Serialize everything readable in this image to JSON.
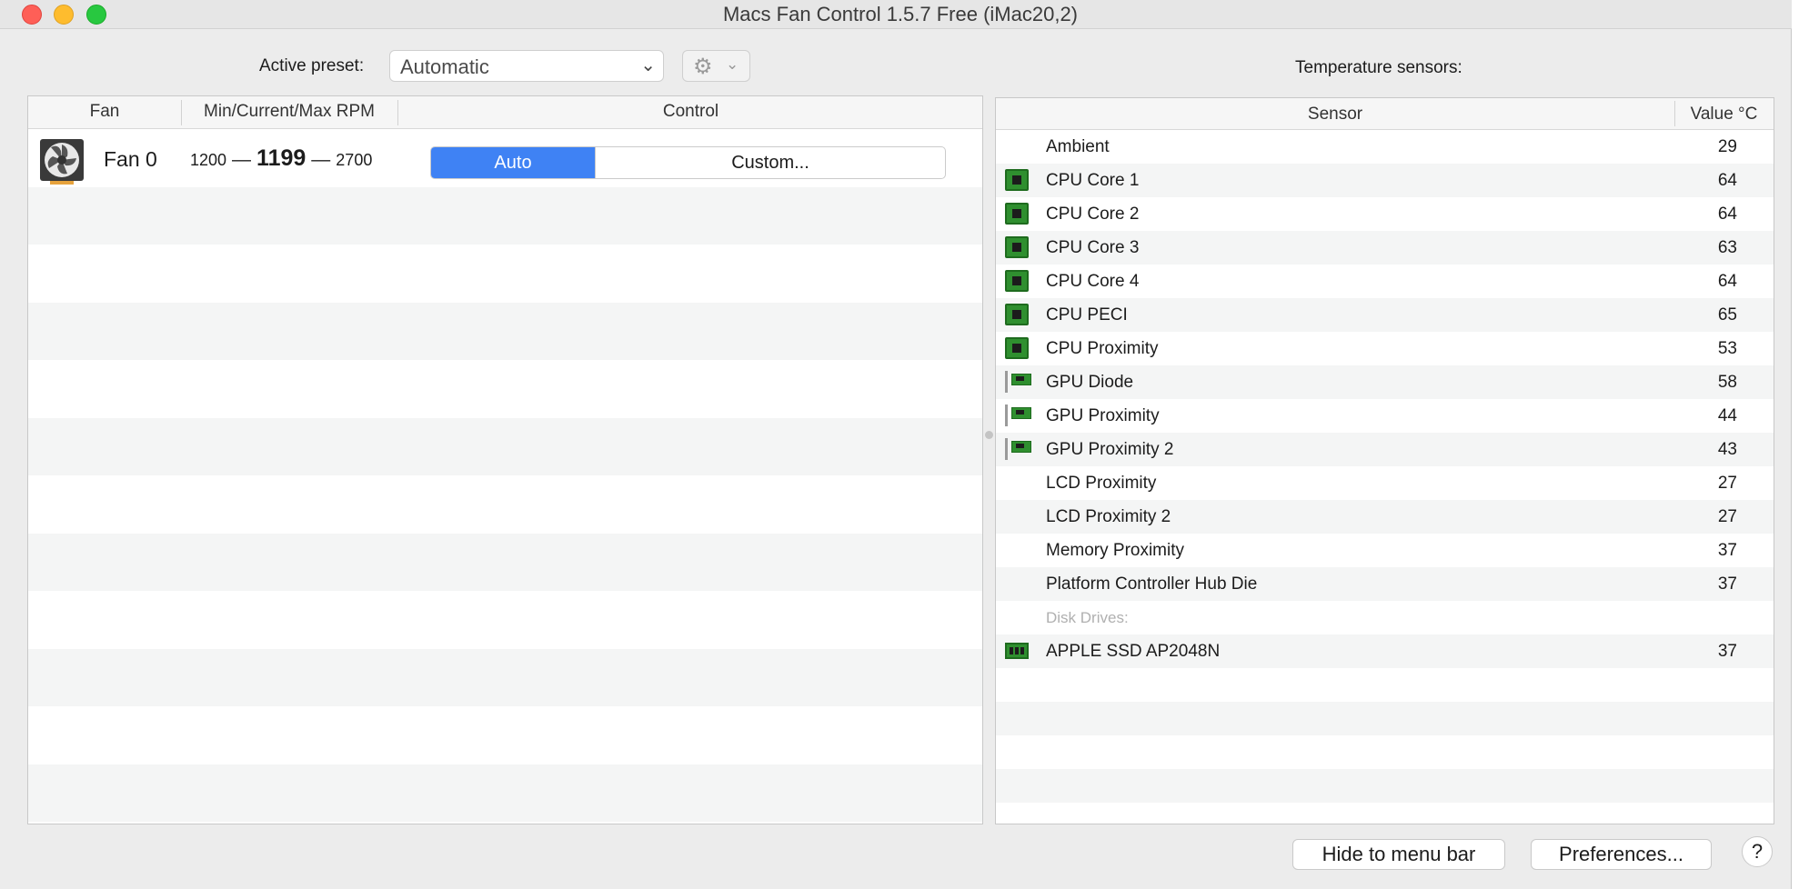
{
  "window": {
    "title": "Macs Fan Control 1.5.7 Free (iMac20,2)"
  },
  "toolbar": {
    "preset_label": "Active preset:",
    "preset_value": "Automatic"
  },
  "fans": {
    "headers": {
      "fan": "Fan",
      "rpm": "Min/Current/Max RPM",
      "control": "Control"
    },
    "rows": [
      {
        "name": "Fan 0",
        "min": "1200",
        "current": "1199",
        "max": "2700",
        "dash": "—",
        "control_auto": "Auto",
        "control_custom": "Custom...",
        "selected": "Auto"
      }
    ]
  },
  "sensors": {
    "caption": "Temperature sensors:",
    "headers": {
      "sensor": "Sensor",
      "value": "Value °C"
    },
    "rows": [
      {
        "icon": "none",
        "name": "Ambient",
        "value": "29"
      },
      {
        "icon": "cpu-chip-icon",
        "name": "CPU Core 1",
        "value": "64"
      },
      {
        "icon": "cpu-chip-icon",
        "name": "CPU Core 2",
        "value": "64"
      },
      {
        "icon": "cpu-chip-icon",
        "name": "CPU Core 3",
        "value": "63"
      },
      {
        "icon": "cpu-chip-icon",
        "name": "CPU Core 4",
        "value": "64"
      },
      {
        "icon": "cpu-chip-icon",
        "name": "CPU PECI",
        "value": "65"
      },
      {
        "icon": "cpu-chip-icon",
        "name": "CPU Proximity",
        "value": "53"
      },
      {
        "icon": "gpu-card-icon",
        "name": "GPU Diode",
        "value": "58"
      },
      {
        "icon": "gpu-card-icon",
        "name": "GPU Proximity",
        "value": "44"
      },
      {
        "icon": "gpu-card-icon",
        "name": "GPU Proximity 2",
        "value": "43"
      },
      {
        "icon": "none",
        "name": "LCD Proximity",
        "value": "27"
      },
      {
        "icon": "none",
        "name": "LCD Proximity 2",
        "value": "27"
      },
      {
        "icon": "none",
        "name": "Memory Proximity",
        "value": "37"
      },
      {
        "icon": "none",
        "name": "Platform Controller Hub Die",
        "value": "37"
      },
      {
        "icon": "none",
        "name": "Disk Drives:",
        "value": "",
        "section": true
      },
      {
        "icon": "ssd-drive-icon",
        "name": "APPLE SSD AP2048N",
        "value": "37"
      }
    ]
  },
  "footer": {
    "hide_label": "Hide to menu bar",
    "prefs_label": "Preferences...",
    "help_label": "?"
  },
  "colors": {
    "accent": "#3f82f4",
    "chip_green": "#2f8f2f",
    "section_text": "#b0b0b0"
  }
}
